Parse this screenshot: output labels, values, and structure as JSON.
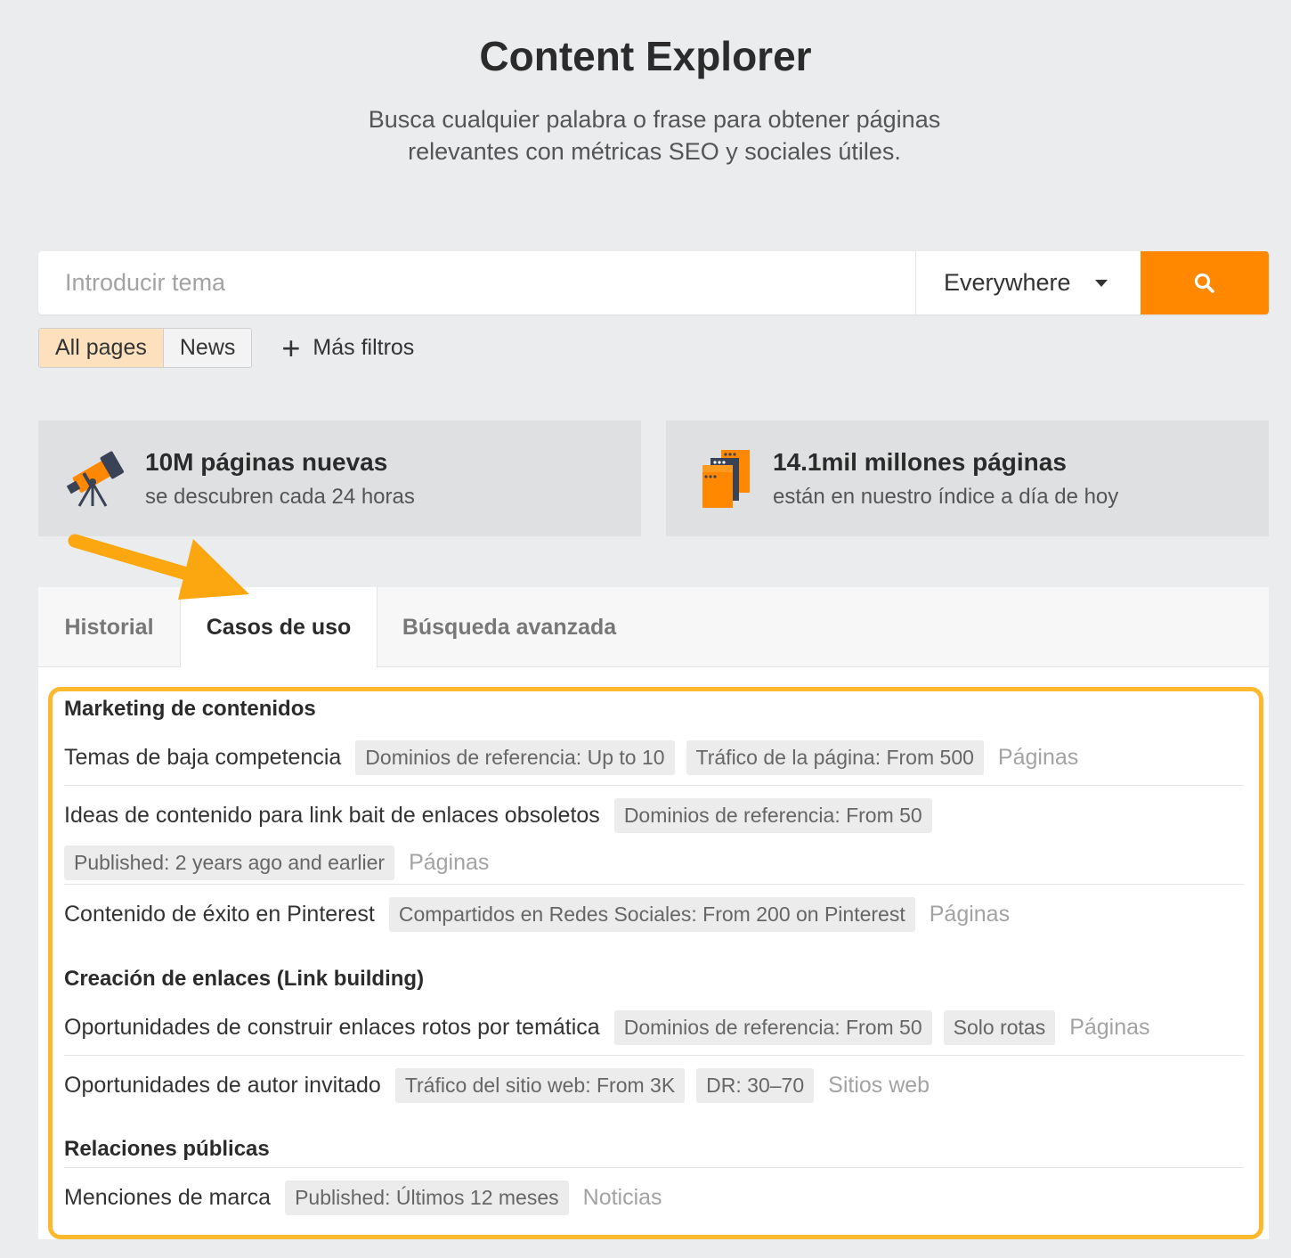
{
  "header": {
    "title": "Content Explorer",
    "subtitle": "Busca cualquier palabra o frase para obtener páginas relevantes con métricas SEO y sociales útiles."
  },
  "search": {
    "placeholder": "Introducir tema",
    "scope": "Everywhere",
    "button_icon": "search-icon"
  },
  "filters": {
    "all_pages": "All pages",
    "news": "News",
    "more_filters": "Más filtros",
    "selected": "All pages"
  },
  "stats": [
    {
      "icon": "telescope-icon",
      "headline": "10M páginas nuevas",
      "detail": "se descubren cada 24 horas"
    },
    {
      "icon": "stacked-pages-icon",
      "headline": "14.1mil millones páginas",
      "detail": "están en nuestro índice a día de hoy"
    }
  ],
  "tabs": [
    {
      "label": "Historial"
    },
    {
      "label": "Casos de uso"
    },
    {
      "label": "Búsqueda avanzada"
    }
  ],
  "active_tab": "Casos de uso",
  "use_cases": {
    "sections": [
      {
        "title": "Marketing de contenidos",
        "items": [
          {
            "label": "Temas de baja competencia",
            "chips": [
              "Dominios de referencia: Up to 10",
              "Tráfico de la página: From 500"
            ],
            "result": "Páginas"
          },
          {
            "label": "Ideas de contenido para link bait de enlaces obsoletos",
            "chips": [
              "Dominios de referencia: From 50",
              "Published: 2 years ago and earlier"
            ],
            "result": "Páginas"
          },
          {
            "label": "Contenido de éxito en Pinterest",
            "chips": [
              "Compartidos en Redes Sociales: From 200 on Pinterest"
            ],
            "result": "Páginas"
          }
        ]
      },
      {
        "title": "Creación de enlaces (Link building)",
        "items": [
          {
            "label": "Oportunidades de construir enlaces rotos por temática",
            "chips": [
              "Dominios de referencia: From 50",
              "Solo rotas"
            ],
            "result": "Páginas"
          },
          {
            "label": "Oportunidades de autor invitado",
            "chips": [
              "Tráfico del sitio web: From 3K",
              "DR: 30–70"
            ],
            "result": "Sitios web"
          }
        ]
      },
      {
        "title": "Relaciones públicas",
        "items": [
          {
            "label": "Menciones de marca",
            "chips": [
              "Published: Últimos 12 meses"
            ],
            "result": "Noticias"
          }
        ]
      }
    ]
  },
  "colors": {
    "accent": "#ff8800",
    "highlight": "#fdb92d",
    "active_filter": "#fde1bf",
    "background": "#ebecee"
  }
}
